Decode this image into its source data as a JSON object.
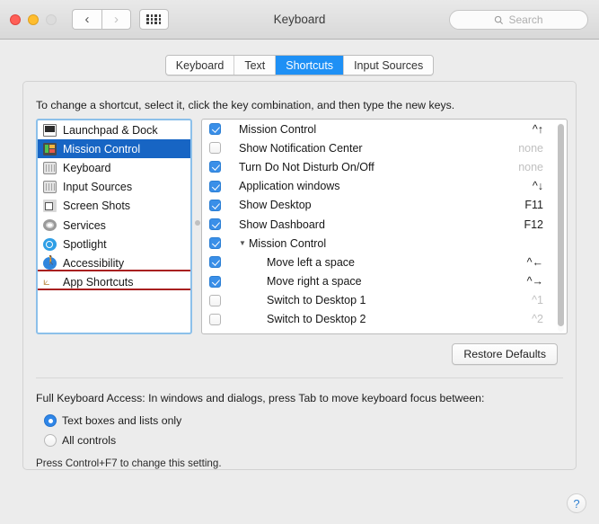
{
  "window": {
    "title": "Keyboard",
    "traffic_lights": [
      "close",
      "minimize",
      "zoom"
    ],
    "nav_back": "‹",
    "nav_forward": "›"
  },
  "search": {
    "placeholder": "Search",
    "value": "",
    "icon": "search-icon"
  },
  "tabs": [
    {
      "label": "Keyboard",
      "active": false
    },
    {
      "label": "Text",
      "active": false
    },
    {
      "label": "Shortcuts",
      "active": true
    },
    {
      "label": "Input Sources",
      "active": false
    }
  ],
  "hint": "To change a shortcut, select it, click the key combination, and then type the new keys.",
  "categories": [
    {
      "label": "Launchpad & Dock",
      "icon": "laptop-icon",
      "selected": false
    },
    {
      "label": "Mission Control",
      "icon": "mission-control-icon",
      "selected": true
    },
    {
      "label": "Keyboard",
      "icon": "keyboard-icon",
      "selected": false
    },
    {
      "label": "Input Sources",
      "icon": "keyboard-icon",
      "selected": false
    },
    {
      "label": "Screen Shots",
      "icon": "camera-icon",
      "selected": false
    },
    {
      "label": "Services",
      "icon": "gear-icon",
      "selected": false
    },
    {
      "label": "Spotlight",
      "icon": "magnifier-icon",
      "selected": false
    },
    {
      "label": "Accessibility",
      "icon": "accessibility-icon",
      "selected": false
    },
    {
      "label": "App Shortcuts",
      "icon": "app-shortcuts-icon",
      "selected": false,
      "highlighted": true
    }
  ],
  "shortcuts": [
    {
      "label": "Mission Control",
      "key": "^↑",
      "checked": true,
      "level": 0,
      "key_style": "normal"
    },
    {
      "label": "Show Notification Center",
      "key": "none",
      "checked": false,
      "level": 0,
      "key_style": "none"
    },
    {
      "label": "Turn Do Not Disturb On/Off",
      "key": "none",
      "checked": true,
      "level": 0,
      "key_style": "none"
    },
    {
      "label": "Application windows",
      "key": "^↓",
      "checked": true,
      "level": 0,
      "key_style": "normal"
    },
    {
      "label": "Show Desktop",
      "key": "F11",
      "checked": true,
      "level": 0,
      "key_style": "normal"
    },
    {
      "label": "Show Dashboard",
      "key": "F12",
      "checked": true,
      "level": 0,
      "key_style": "normal"
    },
    {
      "label": "Mission Control",
      "key": "",
      "checked": true,
      "level": 0,
      "group": true,
      "disclosure": "▼",
      "key_style": "normal"
    },
    {
      "label": "Move left a space",
      "key": "^←",
      "checked": true,
      "level": 1,
      "key_style": "normal"
    },
    {
      "label": "Move right a space",
      "key": "^→",
      "checked": true,
      "level": 1,
      "key_style": "normal"
    },
    {
      "label": "Switch to Desktop 1",
      "key": "^1",
      "checked": false,
      "level": 1,
      "key_style": "dim"
    },
    {
      "label": "Switch to Desktop 2",
      "key": "^2",
      "checked": false,
      "level": 1,
      "key_style": "dim"
    }
  ],
  "restore_defaults_label": "Restore Defaults",
  "full_keyboard_access": {
    "label": "Full Keyboard Access: In windows and dialogs, press Tab to move keyboard focus between:",
    "options": [
      {
        "label": "Text boxes and lists only",
        "selected": true
      },
      {
        "label": "All controls",
        "selected": false
      }
    ],
    "note": "Press Control+F7 to change this setting."
  },
  "help_label": "?",
  "colors": {
    "accent": "#1e90f5",
    "selection": "#1765c4",
    "annotation": "#a81f1f"
  }
}
